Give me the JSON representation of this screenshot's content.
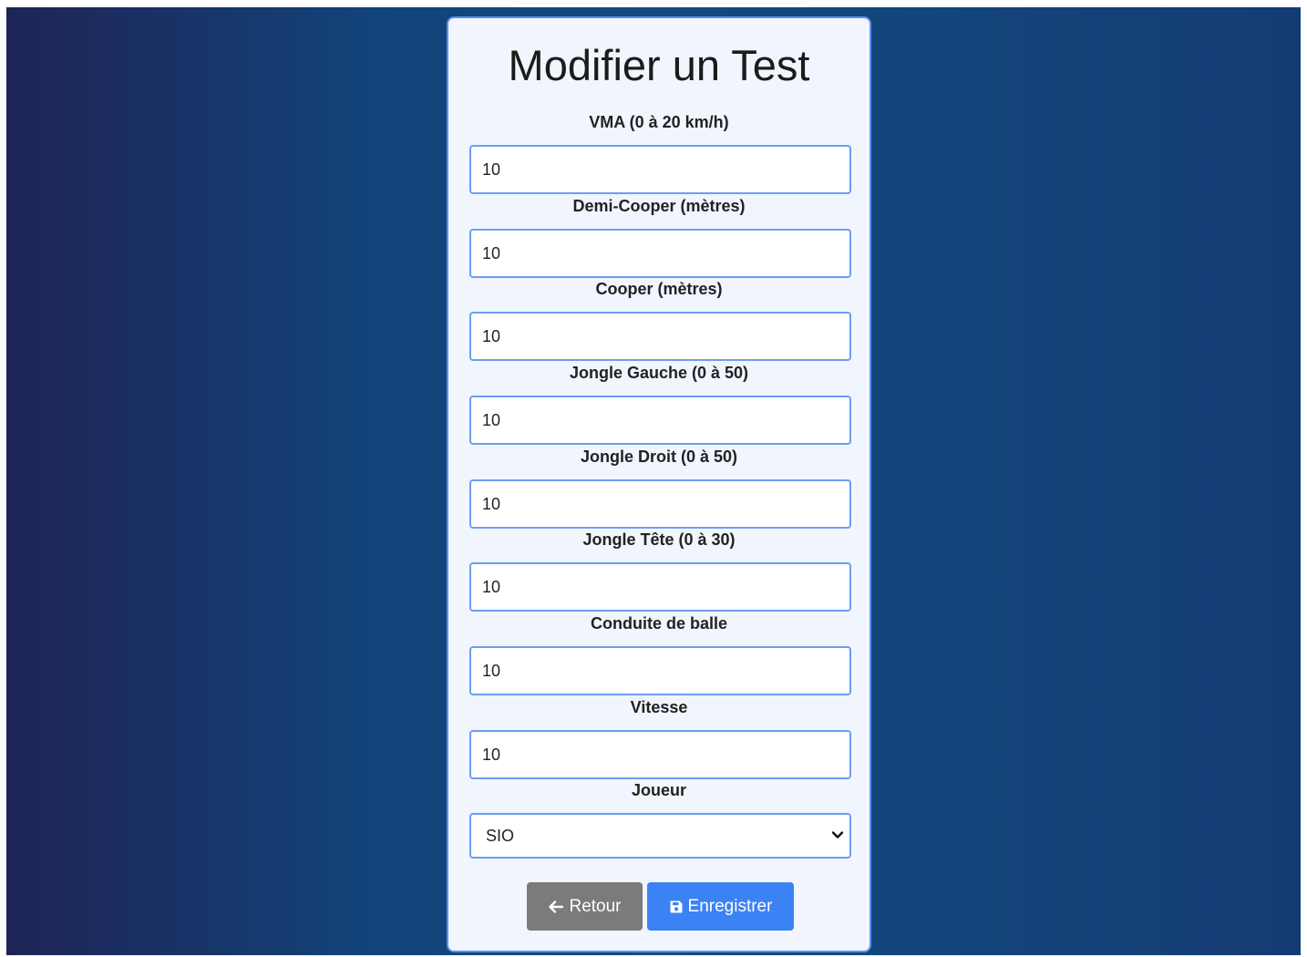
{
  "form": {
    "title": "Modifier un Test",
    "fields": [
      {
        "label": "VMA (0 à 20 km/h)",
        "value": "10"
      },
      {
        "label": "Demi-Cooper (mètres)",
        "value": "10"
      },
      {
        "label": "Cooper (mètres)",
        "value": "10"
      },
      {
        "label": "Jongle Gauche (0 à 50)",
        "value": "10"
      },
      {
        "label": "Jongle Droit (0 à 50)",
        "value": "10"
      },
      {
        "label": "Jongle Tête (0 à 30)",
        "value": "10"
      },
      {
        "label": "Conduite de balle",
        "value": "10"
      },
      {
        "label": "Vitesse",
        "value": "10"
      }
    ],
    "player": {
      "label": "Joueur",
      "selected": "SIO"
    },
    "buttons": {
      "back_label": "Retour",
      "save_label": "Enregistrer"
    }
  },
  "icons": {
    "back": "arrow-left-icon",
    "save": "floppy-disk-icon",
    "dropdown": "chevron-down-icon"
  },
  "colors": {
    "card_border": "#5b8ff0",
    "input_border": "#6d9df0",
    "back_button": "#7b7b7b",
    "save_button": "#3b82f4"
  }
}
